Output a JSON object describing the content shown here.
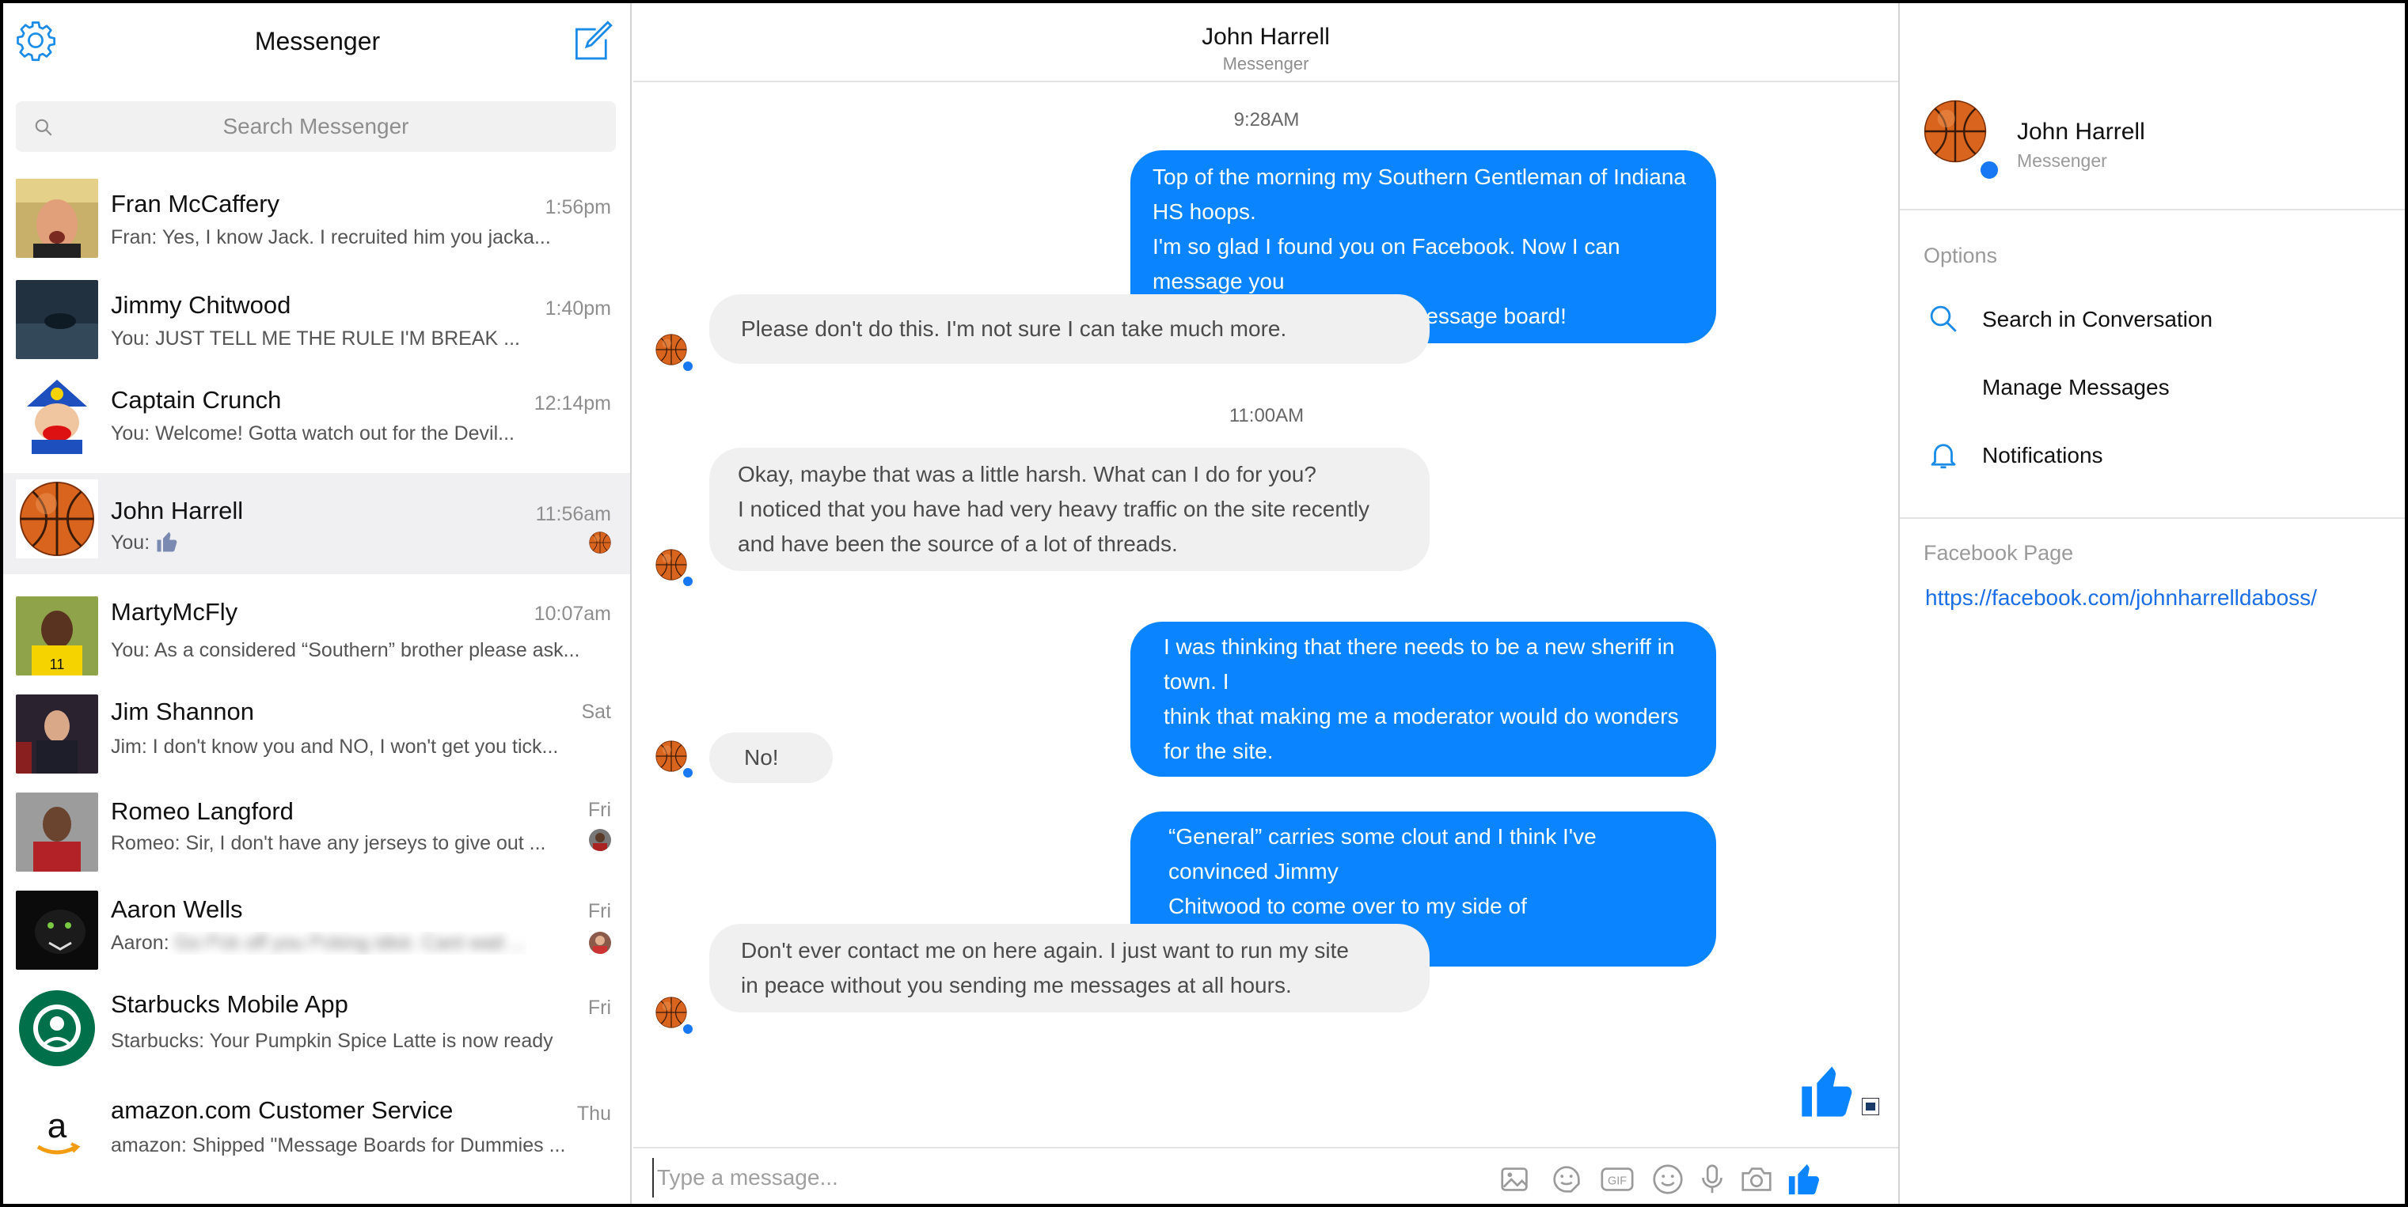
{
  "app": {
    "title": "Messenger"
  },
  "search": {
    "placeholder": "Search Messenger"
  },
  "conversations": [
    {
      "name": "Fran McCaffery",
      "preview": "Fran: Yes, I know Jack.  I recruited him you jacka...",
      "time": "1:56pm",
      "avatar_icon": "photo-fran-icon"
    },
    {
      "name": "Jimmy Chitwood",
      "preview": "You: JUST TELL ME THE RULE I'M BREAK ...",
      "time": "1:40pm",
      "avatar_icon": "photo-jimmy-icon"
    },
    {
      "name": "Captain Crunch",
      "preview": "You: Welcome!  Gotta watch out for the Devil...",
      "time": "12:14pm",
      "avatar_icon": "photo-captain-icon"
    },
    {
      "name": "John Harrell",
      "preview": "You:",
      "time": "11:56am",
      "avatar_icon": "basketball-icon",
      "active": true
    },
    {
      "name": "MartyMcFly",
      "preview": "You: As a considered “Southern” brother please ask...",
      "time": "10:07am",
      "avatar_icon": "photo-marty-icon"
    },
    {
      "name": "Jim Shannon",
      "preview": "Jim: I don't know you and NO, I won't get you tick...",
      "time": "Sat",
      "avatar_icon": "photo-jim-icon"
    },
    {
      "name": "Romeo Langford",
      "preview": "Romeo: Sir, I don't have any jerseys to give out ...",
      "time": "Fri",
      "avatar_icon": "photo-romeo-icon"
    },
    {
      "name": "Aaron Wells",
      "preview_prefix": "Aaron:",
      "preview_blurred": "Go f*ck off you f*cking idiot.  Cant wait ...",
      "time": "Fri",
      "avatar_icon": "photo-panther-icon"
    },
    {
      "name": "Starbucks Mobile App",
      "preview": "Starbucks: Your Pumpkin Spice Latte is now ready",
      "time": "Fri",
      "avatar_icon": "starbucks-logo-icon"
    },
    {
      "name": "amazon.com Customer Service",
      "preview": "amazon: Shipped \"Message Boards for Dummies ...",
      "time": "Thu",
      "avatar_icon": "amazon-logo-icon"
    }
  ],
  "chat": {
    "name": "John Harrell",
    "subtitle": "Messenger",
    "timestamps": [
      "9:28AM",
      "11:00AM"
    ],
    "messages": [
      {
        "dir": "out",
        "lines": [
          "Top of the morning my Southern Gentleman of Indiana HS hoops.",
          "I'm so glad I found you on Facebook.  Now I can message you",
          "with all my worries on the message board!"
        ]
      },
      {
        "dir": "in",
        "lines": [
          "Please don't do this.  I'm not sure I can take much more."
        ]
      },
      {
        "dir": "in",
        "lines": [
          "Okay, maybe that was a little harsh.  What can I do for you?",
          "I noticed that you have had very heavy traffic on the site recently",
          "and have been the source of a lot of threads."
        ]
      },
      {
        "dir": "out",
        "lines": [
          "I was thinking that there needs to be a new sheriff in town.  I",
          "think that making me a moderator would do wonders for the site."
        ]
      },
      {
        "dir": "in",
        "lines": [
          "No!"
        ]
      },
      {
        "dir": "out",
        "lines": [
          "“General” carries some clout and I think I've convinced Jimmy",
          "Chitwood to come over to my side of thinking...eventually."
        ]
      },
      {
        "dir": "in",
        "lines": [
          "Don't ever contact me on here again.  I just want to run my site",
          "in peace without you sending me messages at all hours."
        ]
      }
    ],
    "composer_placeholder": "Type a message...",
    "composer_icons": [
      "image-icon",
      "sticker-icon",
      "gif-icon",
      "emoji-icon",
      "microphone-icon",
      "camera-icon",
      "thumbs-up-icon"
    ]
  },
  "details": {
    "name": "John Harrell",
    "subtitle": "Messenger",
    "options_label": "Options",
    "options": [
      {
        "label": "Search in Conversation",
        "icon": "search-icon"
      },
      {
        "label": "Manage Messages",
        "icon": ""
      },
      {
        "label": "Notifications",
        "icon": "bell-icon"
      }
    ],
    "page_label": "Facebook Page",
    "page_link": "https://facebook.com/johnharrelldaboss/"
  },
  "colors": {
    "accent": "#0a84ff",
    "incoming_bubble": "#f0f0f0",
    "link": "#1a6fe6"
  }
}
